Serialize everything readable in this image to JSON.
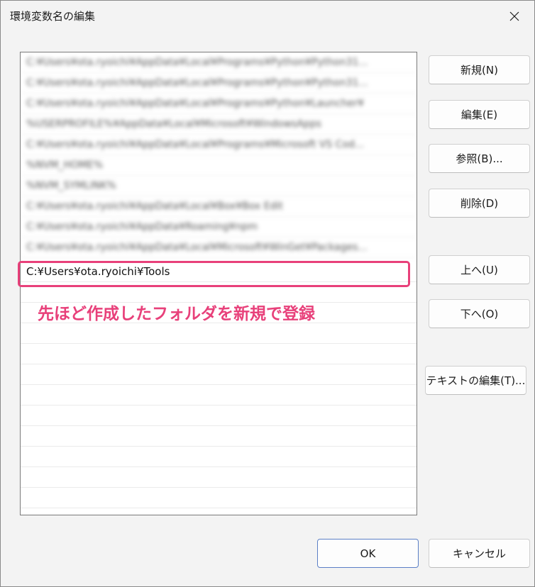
{
  "window": {
    "title": "環境変数名の編集",
    "close_icon": "close-icon"
  },
  "list": {
    "blurred_rows": [
      "C:¥Users¥ota.ryoichi¥AppData¥Local¥Programs¥Python¥Python31...",
      "C:¥Users¥ota.ryoichi¥AppData¥Local¥Programs¥Python¥Python31...",
      "C:¥Users¥ota.ryoichi¥AppData¥Local¥Programs¥Python¥Launcher¥",
      "%USERPROFILE%¥AppData¥Local¥Microsoft¥WindowsApps",
      "C:¥Users¥ota.ryoichi¥AppData¥Local¥Programs¥Microsoft VS Cod...",
      "%NVM_HOME%",
      "%NVM_SYMLINK%",
      "C:¥Users¥ota.ryoichi¥AppData¥Local¥Box¥Box Edit",
      "C:¥Users¥ota.ryoichi¥AppData¥Roaming¥npm",
      "C:¥Users¥ota.ryoichi¥AppData¥Local¥Microsoft¥WinGet¥Packages..."
    ],
    "editing_value": "C:¥Users¥ota.ryoichi¥Tools"
  },
  "annotation": "先ほど作成したフォルダを新規で登録",
  "buttons": {
    "new": "新規(N)",
    "edit": "編集(E)",
    "browse": "参照(B)...",
    "delete": "削除(D)",
    "up": "上へ(U)",
    "down": "下へ(O)",
    "edit_text": "テキストの編集(T)...",
    "ok": "OK",
    "cancel": "キャンセル"
  },
  "colors": {
    "annotation": "#e8407a",
    "primary_border": "#5b7fc6"
  }
}
